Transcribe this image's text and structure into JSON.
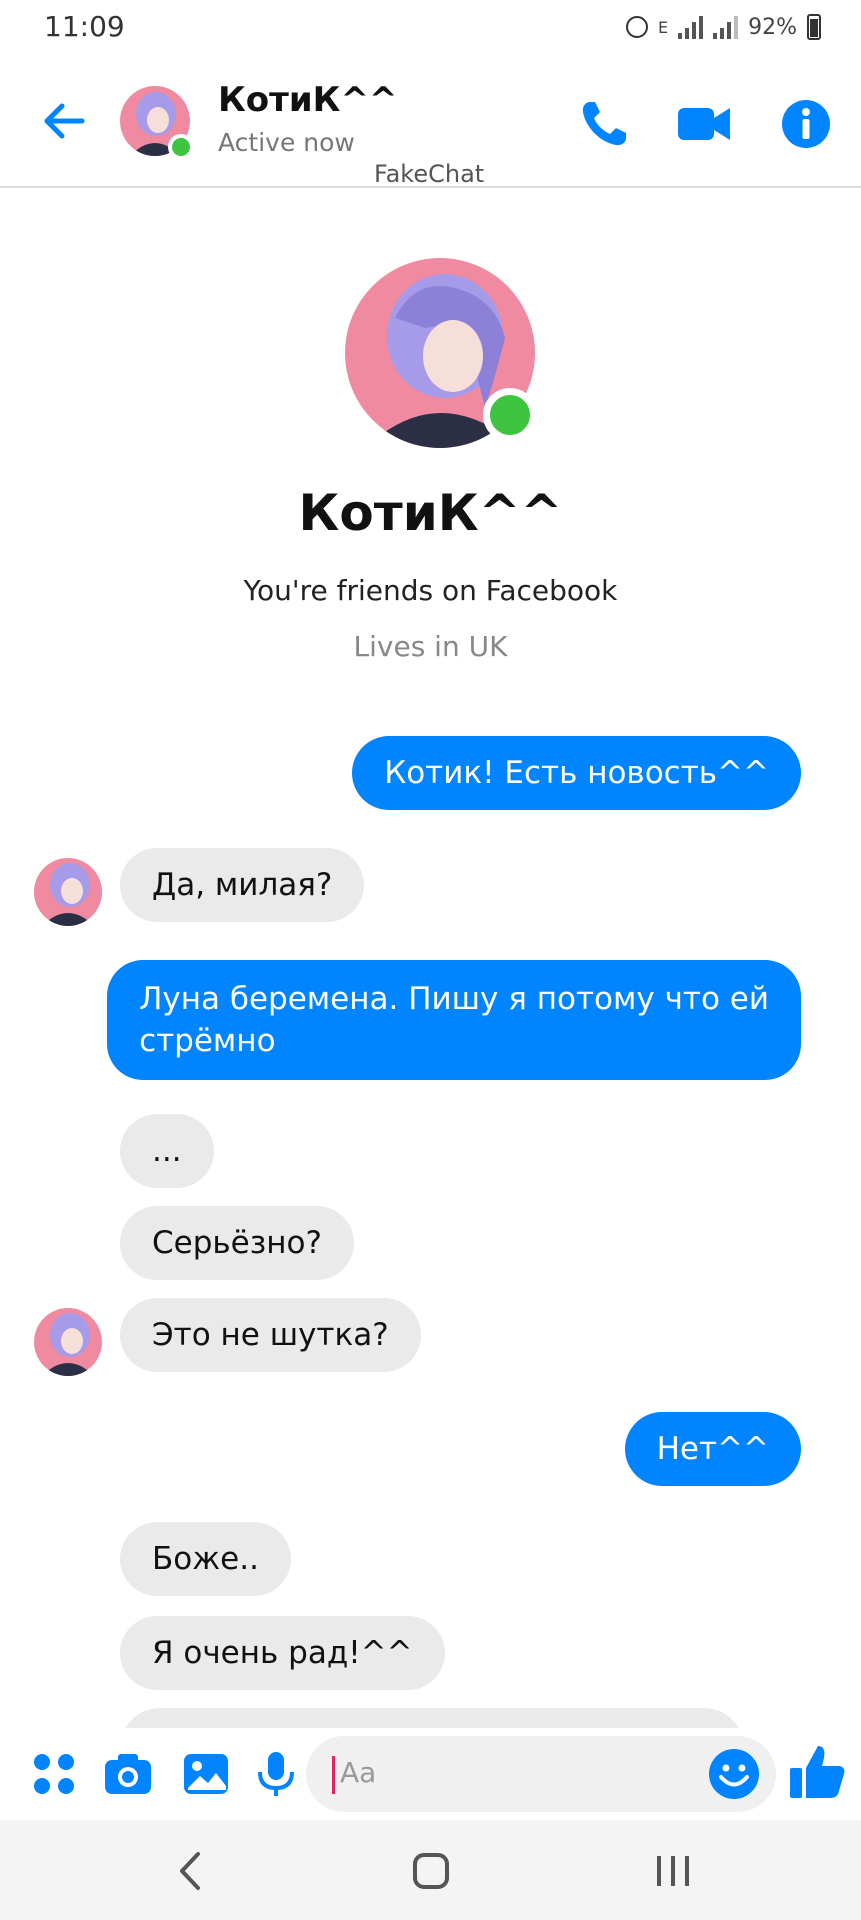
{
  "status_bar": {
    "time": "11:09",
    "battery": "92%",
    "network": "E"
  },
  "header": {
    "contact_name": "КотиК^^",
    "presence": "Active now",
    "watermark": "FakeChat",
    "icons": [
      "back-arrow-icon",
      "phone-icon",
      "video-icon",
      "info-icon"
    ]
  },
  "profile": {
    "name": "КотиК^^",
    "friends_text": "You're friends on Facebook",
    "lives_text": "Lives in UK"
  },
  "messages": [
    {
      "from": "me",
      "text": "Котик! Есть новость^^"
    },
    {
      "from": "them",
      "text": "Да, милая?"
    },
    {
      "from": "me",
      "lines": [
        "Луна беремена. Пишу я потому что ей",
        "стрёмно"
      ]
    },
    {
      "from": "them",
      "text": "..."
    },
    {
      "from": "them",
      "text": "Серьёзно?"
    },
    {
      "from": "them",
      "text": "Это не шутка?"
    },
    {
      "from": "me",
      "text": "Нет^^"
    },
    {
      "from": "them",
      "text": "Боже.."
    },
    {
      "from": "them",
      "text": "Я очень рад!^^"
    }
  ],
  "composer": {
    "placeholder": "Aa",
    "icons": [
      "apps-icon",
      "camera-icon",
      "gallery-icon",
      "microphone-icon",
      "emoji-icon",
      "like-icon"
    ]
  },
  "colors": {
    "accent": "#0084ff",
    "incoming_bubble": "#eaeaea",
    "online": "#3ec43e"
  }
}
